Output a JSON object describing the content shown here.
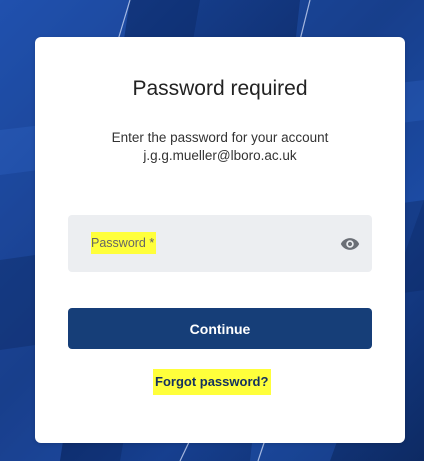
{
  "colors": {
    "background": "#12367f",
    "card": "#ffffff",
    "button": "#163e78",
    "highlight": "#ffff3b",
    "field": "#eceef1"
  },
  "card": {
    "title": "Password required",
    "subtitle_line1": "Enter the password for your account",
    "subtitle_line2": "j.g.g.mueller@lboro.ac.uk",
    "password_field": {
      "placeholder": "Password *",
      "value": "",
      "toggle_icon": "eye-icon"
    },
    "continue_label": "Continue",
    "forgot_label": "Forgot password?"
  }
}
